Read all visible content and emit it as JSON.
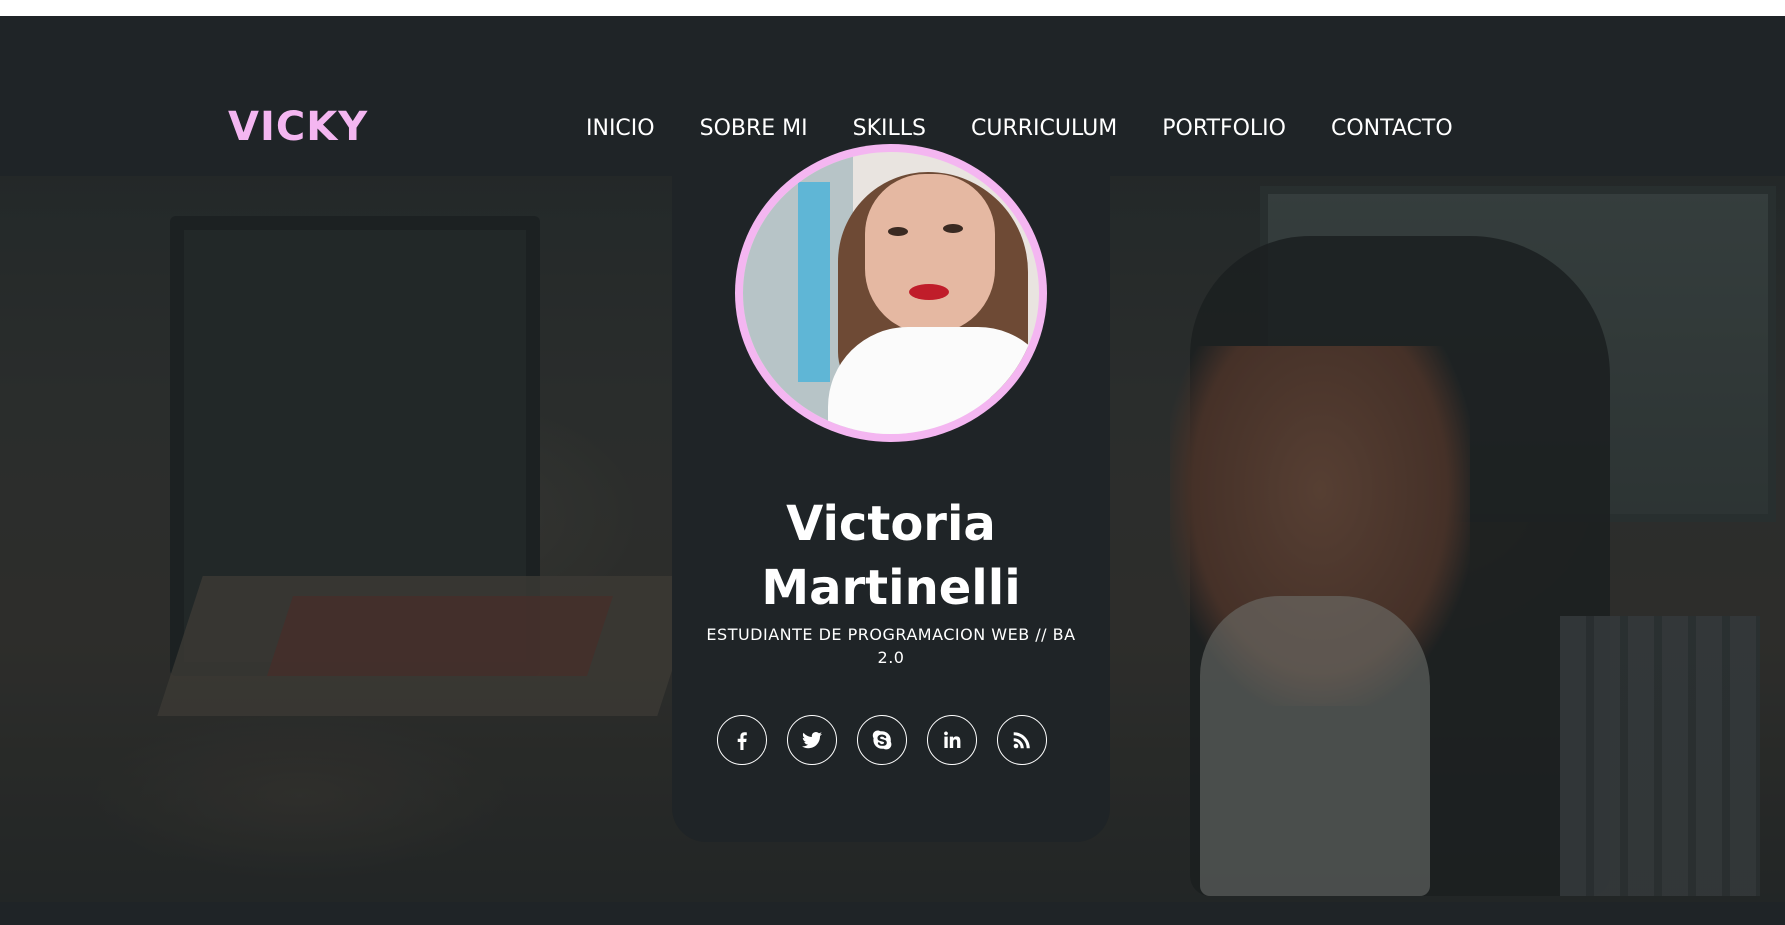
{
  "brand": {
    "logo_text": "VICKY",
    "accent_color": "#f4b6f1"
  },
  "nav": {
    "items": [
      {
        "label": "INICIO"
      },
      {
        "label": "SOBRE MI"
      },
      {
        "label": "SKILLS"
      },
      {
        "label": "CURRICULUM"
      },
      {
        "label": "PORTFOLIO"
      },
      {
        "label": "CONTACTO"
      }
    ]
  },
  "profile": {
    "name": "Victoria Martinelli",
    "subtitle": "ESTUDIANTE DE PROGRAMACION WEB // BA 2.0",
    "photo_icon": "profile-photo"
  },
  "socials": [
    {
      "icon": "facebook-icon"
    },
    {
      "icon": "twitter-icon"
    },
    {
      "icon": "skype-icon"
    },
    {
      "icon": "linkedin-icon"
    },
    {
      "icon": "rss-icon"
    }
  ],
  "colors": {
    "panel": "#1f2427",
    "text": "#ffffff"
  }
}
